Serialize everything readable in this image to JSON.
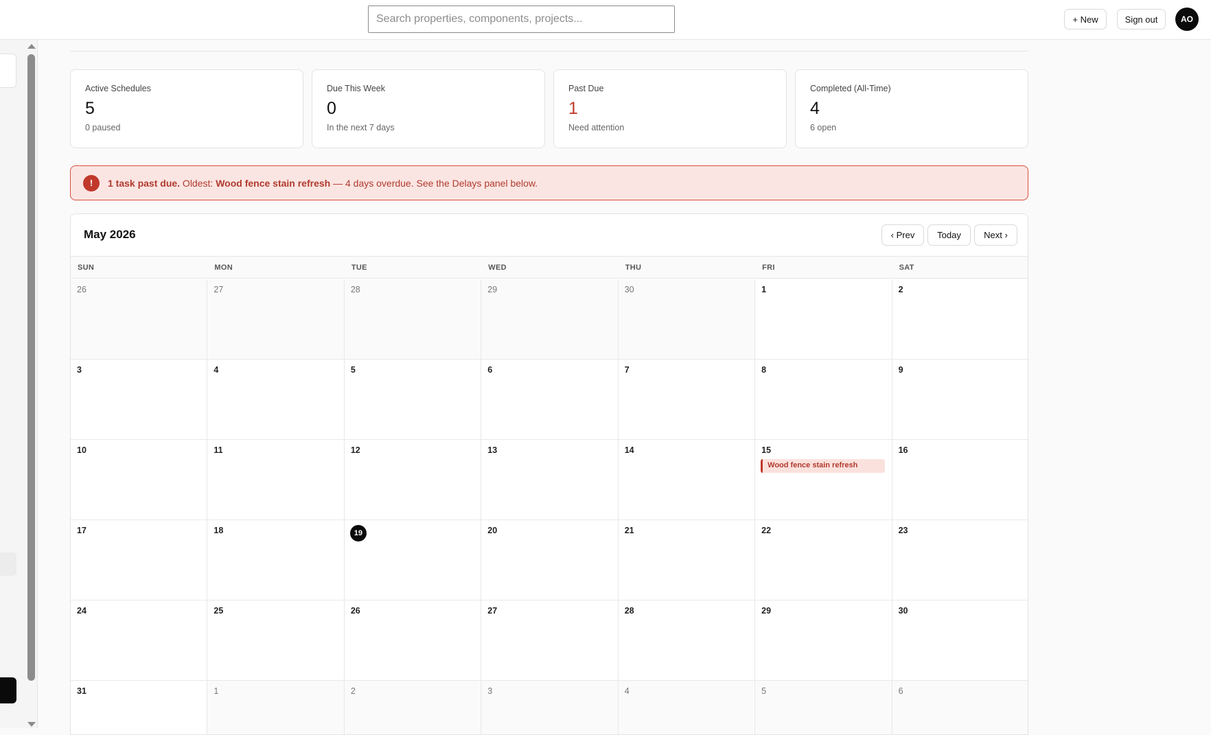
{
  "topbar": {
    "search_placeholder": "Search properties, components, projects...",
    "new_label": "+ New",
    "signout_label": "Sign out",
    "avatar_initials": "AO"
  },
  "stats": [
    {
      "label": "Active Schedules",
      "value": "5",
      "sub": "0 paused"
    },
    {
      "label": "Due This Week",
      "value": "0",
      "sub": "In the next 7 days"
    },
    {
      "label": "Past Due",
      "value": "1",
      "sub": "Need attention"
    },
    {
      "label": "Completed (All-Time)",
      "value": "4",
      "sub": "6 open"
    }
  ],
  "banner": {
    "icon": "!",
    "bold_lead": "1 task past due.",
    "oldest_prefix": " Oldest: ",
    "task_name": "Wood fence stain refresh",
    "rest": " — 4 days overdue. See the Delays panel below."
  },
  "calendar": {
    "title": "May 2026",
    "prev_label": "‹ Prev",
    "today_label": "Today",
    "next_label": "Next ›",
    "days_of_week": [
      "SUN",
      "MON",
      "TUE",
      "WED",
      "THU",
      "FRI",
      "SAT"
    ],
    "today_date": "19",
    "weeks": [
      [
        {
          "d": "26",
          "other": true
        },
        {
          "d": "27",
          "other": true
        },
        {
          "d": "28",
          "other": true
        },
        {
          "d": "29",
          "other": true
        },
        {
          "d": "30",
          "other": true
        },
        {
          "d": "1"
        },
        {
          "d": "2"
        }
      ],
      [
        {
          "d": "3"
        },
        {
          "d": "4"
        },
        {
          "d": "5"
        },
        {
          "d": "6"
        },
        {
          "d": "7"
        },
        {
          "d": "8"
        },
        {
          "d": "9"
        }
      ],
      [
        {
          "d": "10"
        },
        {
          "d": "11"
        },
        {
          "d": "12"
        },
        {
          "d": "13"
        },
        {
          "d": "14"
        },
        {
          "d": "15",
          "event": "Wood fence stain refresh"
        },
        {
          "d": "16"
        }
      ],
      [
        {
          "d": "17"
        },
        {
          "d": "18"
        },
        {
          "d": "19",
          "today": true
        },
        {
          "d": "20"
        },
        {
          "d": "21"
        },
        {
          "d": "22"
        },
        {
          "d": "23"
        }
      ],
      [
        {
          "d": "24"
        },
        {
          "d": "25"
        },
        {
          "d": "26"
        },
        {
          "d": "27"
        },
        {
          "d": "28"
        },
        {
          "d": "29"
        },
        {
          "d": "30"
        }
      ],
      [
        {
          "d": "31"
        },
        {
          "d": "1",
          "other": true
        },
        {
          "d": "2",
          "other": true
        },
        {
          "d": "3",
          "other": true
        },
        {
          "d": "4",
          "other": true
        },
        {
          "d": "5",
          "other": true
        },
        {
          "d": "6",
          "other": true
        }
      ]
    ]
  },
  "colors": {
    "accent_danger": "#c0392b",
    "banner_bg": "#fbe5e2",
    "today_dot": "#0b0b0b"
  }
}
